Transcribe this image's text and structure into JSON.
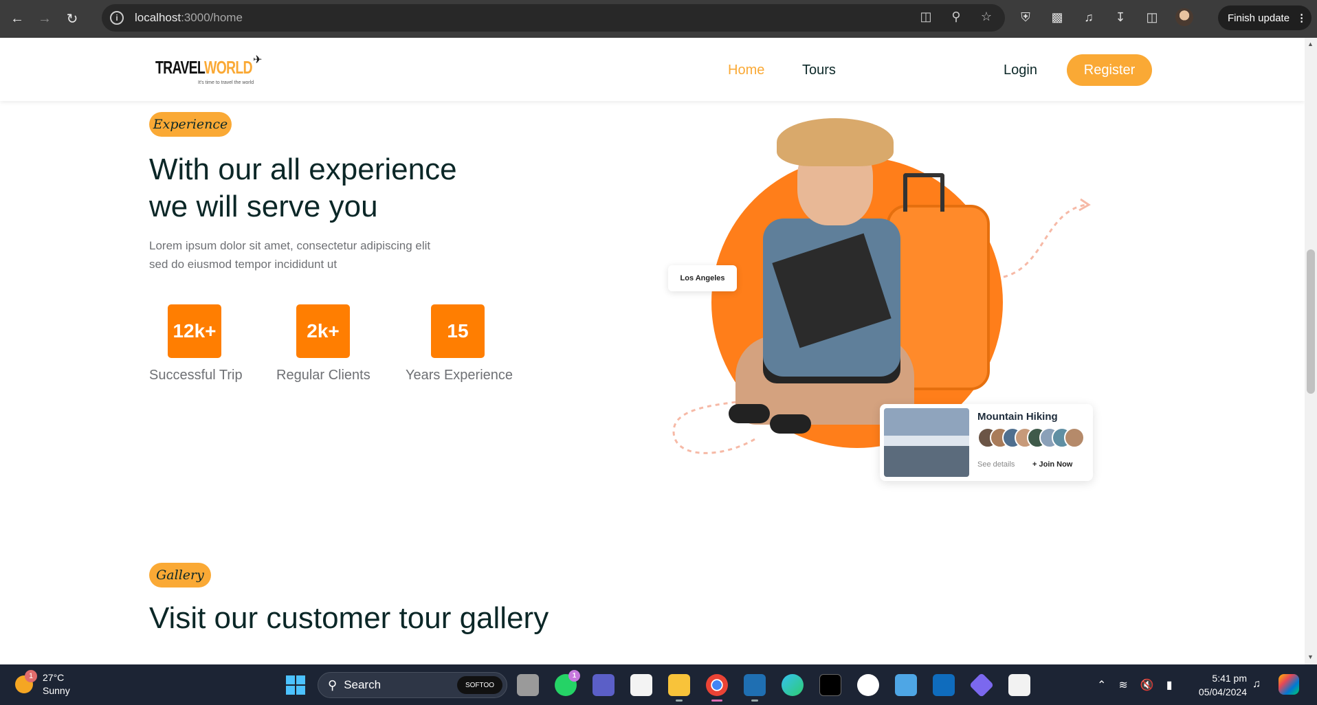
{
  "browser": {
    "url_host": "localhost",
    "url_path": ":3000/home",
    "finish_update_label": "Finish update"
  },
  "header": {
    "logo_text_1": "TRAVEL",
    "logo_text_2": "WORLD",
    "logo_tagline": "It's time to travel the world",
    "nav": [
      {
        "label": "Home",
        "active": true
      },
      {
        "label": "Tours",
        "active": false
      }
    ],
    "login_label": "Login",
    "register_label": "Register"
  },
  "experience": {
    "subtitle": "Experience",
    "headline_line1": "With our all experience",
    "headline_line2": "we will serve you",
    "desc_line1": "Lorem ipsum dolor sit amet, consectetur adipiscing elit",
    "desc_line2": "sed do eiusmod tempor incididunt ut",
    "stats": [
      {
        "value": "12k+",
        "label": "Successful Trip"
      },
      {
        "value": "2k+",
        "label": "Regular Clients"
      },
      {
        "value": "15",
        "label": "Years Experience"
      }
    ],
    "location_tag": "Los Angeles",
    "card": {
      "title": "Mountain Hiking",
      "see_details": "See details",
      "join_now": "+ Join Now"
    }
  },
  "gallery": {
    "subtitle": "Gallery",
    "headline": "Visit our customer tour gallery"
  },
  "taskbar": {
    "temperature": "27°C",
    "condition": "Sunny",
    "weather_badge": "1",
    "search_label": "Search",
    "softoo_label": "SOFTOO",
    "whatsapp_badge": "1",
    "time": "5:41 pm",
    "date": "05/04/2024"
  },
  "colors": {
    "accent": "#faa935",
    "stat_orange": "#ff7e01",
    "heading": "#0b2727"
  }
}
